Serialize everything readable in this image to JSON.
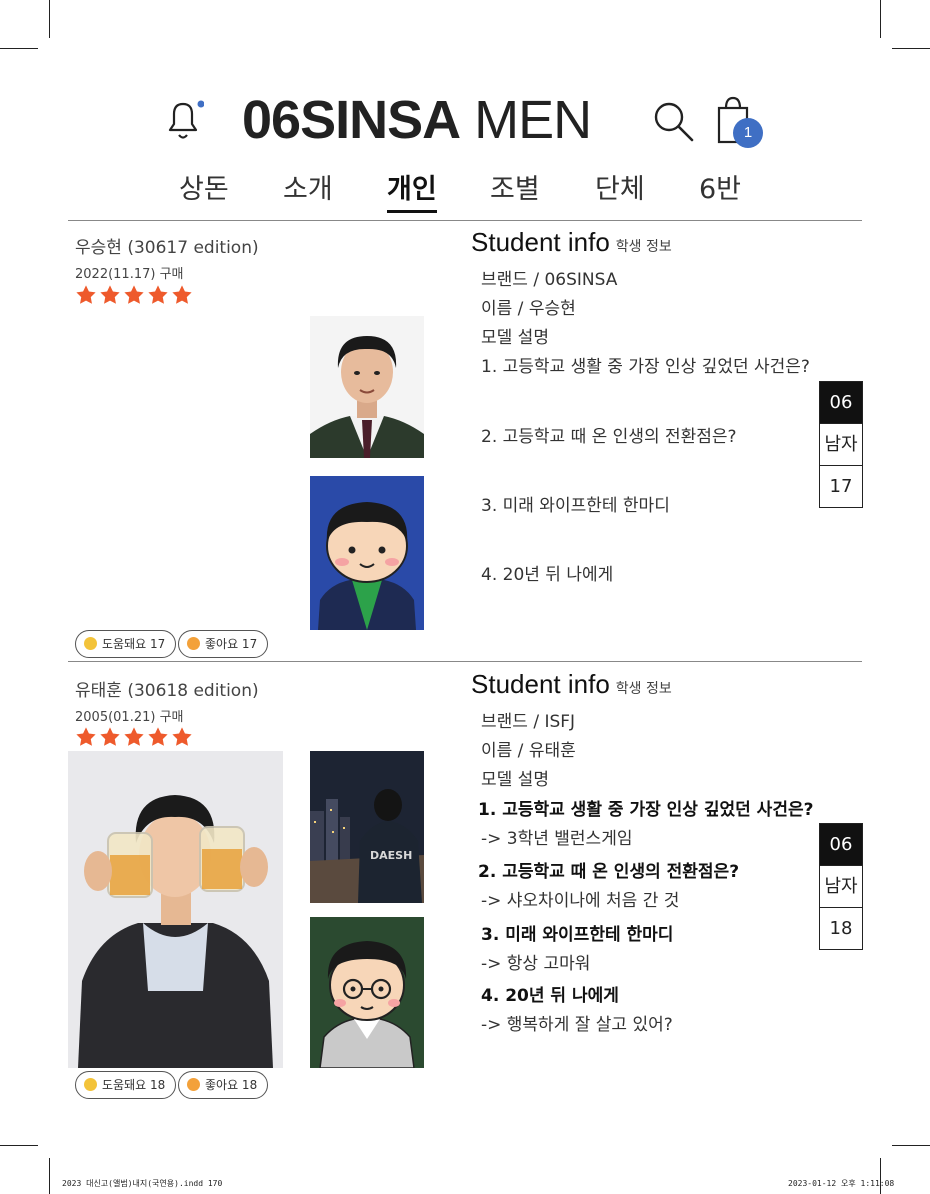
{
  "header": {
    "brand_bold": "06SINSA",
    "brand_light": "MEN",
    "cart_count": "1",
    "accent_color": "#3f6fc4"
  },
  "nav": {
    "items": [
      "상돈",
      "소개",
      "개인",
      "조별",
      "단체",
      "6반"
    ],
    "active": "개인"
  },
  "entries": [
    {
      "name": "우승현 (30617 edition)",
      "date": "2022(11.17) 구매",
      "stars": 5,
      "info_title": "Student info",
      "info_subtitle": "학생 정보",
      "brand": "브랜드 / 06SINSA",
      "person": "이름 / 우승현",
      "model": "모델 설명",
      "questions": [
        {
          "q": "1. 고등학교 생활 중 가장 인상 깊었던 사건은?",
          "a": ""
        },
        {
          "q": "2. 고등학교 때 온 인생의 전환점은?",
          "a": ""
        },
        {
          "q": "3. 미래 와이프한테 한마디",
          "a": ""
        },
        {
          "q": "4. 20년 뒤 나에게",
          "a": ""
        }
      ],
      "helpful": "도움돼요 17",
      "like": "좋아요 17",
      "side": [
        "06",
        "남자",
        "17"
      ]
    },
    {
      "name": "유태훈 (30618 edition)",
      "date": "2005(01.21) 구매",
      "stars": 5,
      "info_title": "Student info",
      "info_subtitle": "학생 정보",
      "brand": "브랜드 / ISFJ",
      "person": "이름 / 유태훈",
      "model": "모델 설명",
      "questions": [
        {
          "q": "1. 고등학교 생활 중 가장 인상 깊었던 사건은?",
          "a": "-> 3학년 밸런스게임"
        },
        {
          "q": "2. 고등학교 때 온 인생의 전환점은?",
          "a": "-> 샤오차이나에 처음 간 것"
        },
        {
          "q": "3. 미래 와이프한테 한마디",
          "a": "-> 항상 고마워"
        },
        {
          "q": "4. 20년 뒤 나에게",
          "a": "-> 행복하게 잘 살고 있어?"
        }
      ],
      "helpful": "도움돼요 18",
      "like": "좋아요 18",
      "side": [
        "06",
        "남자",
        "18"
      ]
    }
  ],
  "footer": {
    "left": "2023 대신고(앨범)내지(국연용).indd   170",
    "right": "2023-01-12   오후 1:11:08"
  }
}
